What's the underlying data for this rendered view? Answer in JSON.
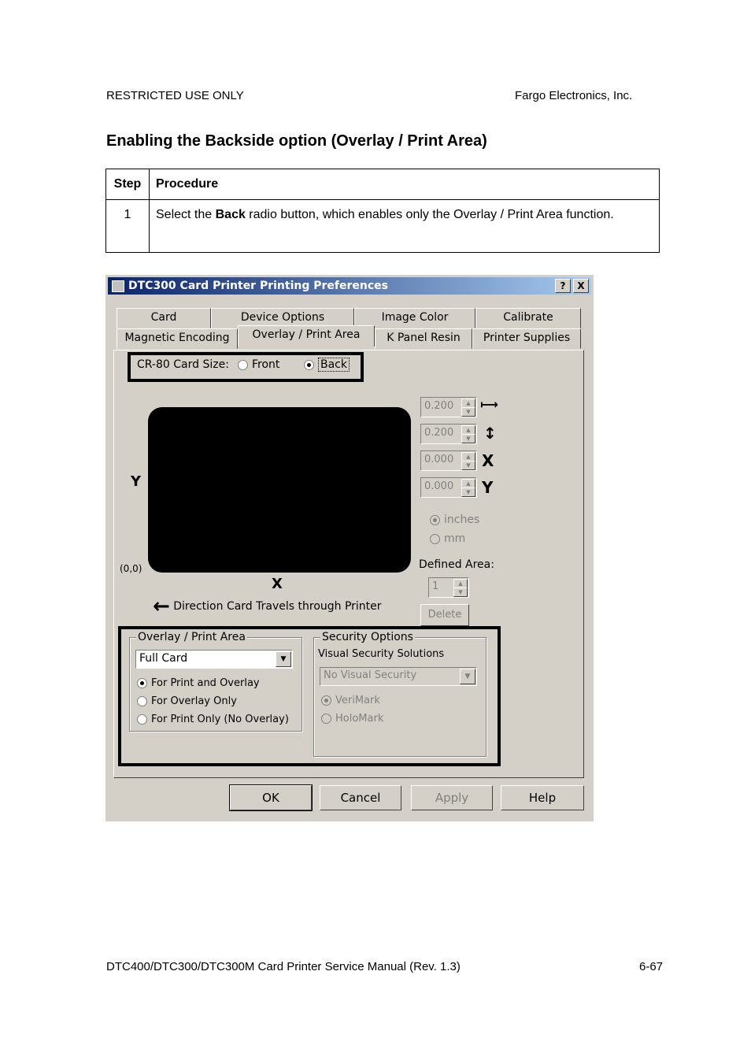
{
  "header": {
    "left": "RESTRICTED USE ONLY",
    "right": "Fargo Electronics, Inc."
  },
  "title": "Enabling the Backside option (Overlay / Print Area)",
  "table": {
    "col_step": "Step",
    "col_procedure": "Procedure",
    "rows": [
      {
        "step": "1",
        "pre": "Select the ",
        "bold": "Back",
        "post": " radio button, which enables only the Overlay / Print Area function."
      }
    ]
  },
  "dialog": {
    "title": "DTC300 Card Printer Printing Preferences",
    "help_btn": "?",
    "close_btn": "X",
    "tabs_row1": [
      "Card",
      "Device Options",
      "Image Color",
      "Calibrate"
    ],
    "tabs_row2": [
      "Magnetic Encoding",
      "Overlay / Print Area",
      "K Panel Resin",
      "Printer Supplies"
    ],
    "selected_tab": "Overlay / Print Area",
    "card_size_label": "CR-80 Card Size:",
    "front_label": "Front",
    "back_label": "Back",
    "selected_side": "Back",
    "y_axis": "Y",
    "x_axis": "X",
    "origin": "(0,0)",
    "spinners": [
      {
        "value": "0.200",
        "icon": "width-arrows-icon",
        "unit": "⟼"
      },
      {
        "value": "0.200",
        "icon": "height-arrows-icon",
        "unit": "↕"
      },
      {
        "value": "0.000",
        "icon": "x-letter-icon",
        "unit": "X"
      },
      {
        "value": "0.000",
        "icon": "y-letter-icon",
        "unit": "Y"
      }
    ],
    "units": {
      "inches": "inches",
      "mm": "mm",
      "selected": "inches"
    },
    "defined_area_label": "Defined Area:",
    "defined_area_value": "1",
    "delete_btn": "Delete",
    "direction_text": "Direction Card Travels through Printer",
    "overlay_group": {
      "label": "Overlay / Print Area",
      "combo_value": "Full Card",
      "options": [
        "For Print and Overlay",
        "For Overlay Only",
        "For Print Only (No Overlay)"
      ],
      "selected": "For Print and Overlay"
    },
    "security_group": {
      "label": "Security Options",
      "sublabel": "Visual Security Solutions",
      "combo_value": "No Visual Security",
      "options": [
        "VeriMark",
        "HoloMark"
      ],
      "selected": "VeriMark"
    },
    "buttons": {
      "ok": "OK",
      "cancel": "Cancel",
      "apply": "Apply",
      "help": "Help"
    }
  },
  "footer": {
    "left": "DTC400/DTC300/DTC300M Card Printer Service Manual (Rev. 1.3)",
    "right": "6-67"
  }
}
